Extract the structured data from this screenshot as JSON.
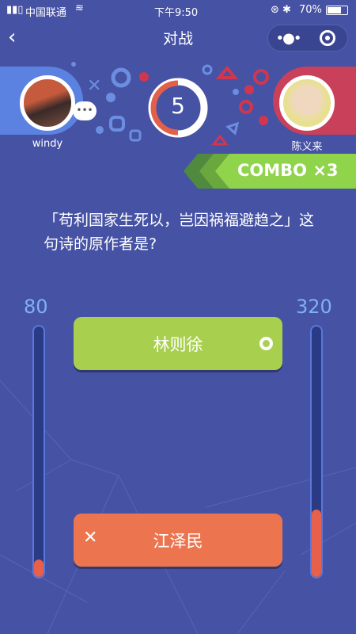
{
  "status_bar": {
    "carrier": "中国联通",
    "time": "下午9:50",
    "battery": "70%"
  },
  "nav": {
    "title": "对战",
    "back_icon": "chevron-left-icon",
    "more_icon": "more-dots-icon",
    "close_icon": "target-circle-icon"
  },
  "players": {
    "left": {
      "name": "windy",
      "color": "#5b82e0"
    },
    "right": {
      "name": "陈义来",
      "color": "#c8405a"
    }
  },
  "timer": {
    "value": "5",
    "remaining_fraction": 0.5
  },
  "combo": {
    "label": "COMBO ×3",
    "color": "#8fd44a"
  },
  "question": "「苟利国家生死以，岂因祸福避趋之」这句诗的原作者是?",
  "scores": {
    "left": {
      "value": "80",
      "fill_fraction": 0.07
    },
    "right": {
      "value": "320",
      "fill_fraction": 0.27
    }
  },
  "answers": [
    {
      "label": "林则徐",
      "state": "correct",
      "color": "#a8d04e"
    },
    {
      "label": "江泽民",
      "state": "wrong",
      "color": "#ec7550"
    }
  ]
}
